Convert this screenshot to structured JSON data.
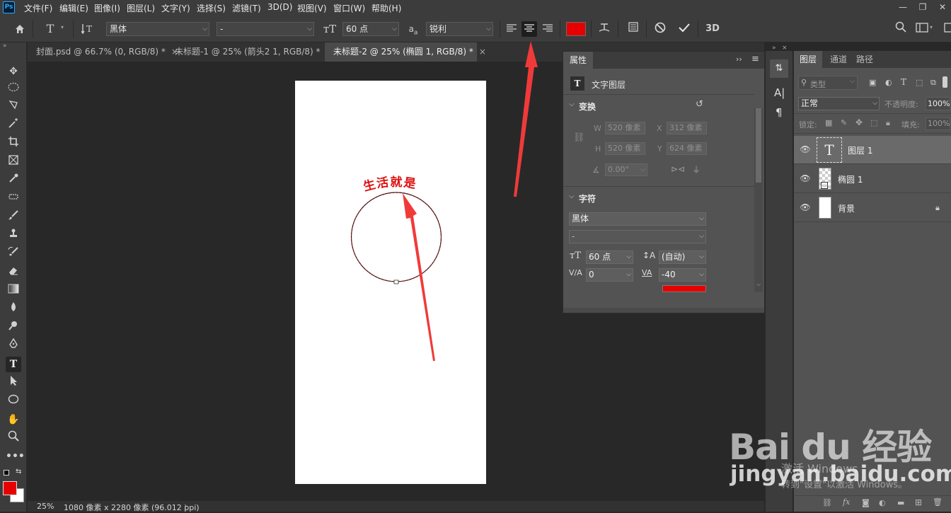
{
  "menubar": {
    "app_icon": "Ps",
    "items": [
      "文件(F)",
      "编辑(E)",
      "图像(I)",
      "图层(L)",
      "文字(Y)",
      "选择(S)",
      "滤镜(T)",
      "3D(D)",
      "视图(V)",
      "窗口(W)",
      "帮助(H)"
    ]
  },
  "options": {
    "font_family": "黑体",
    "font_style": "-",
    "font_size": "60 点",
    "aa_label": "a",
    "antialias": "锐利",
    "threed": "3D",
    "color": "#e60000"
  },
  "tabs": [
    {
      "label": "封面.psd @ 66.7% (0, RGB/8) *"
    },
    {
      "label": "未标题-1 @ 25% (箭头2 1, RGB/8) *"
    },
    {
      "label": "未标题-2 @ 25% (椭圆 1, RGB/8) *"
    }
  ],
  "canvas": {
    "path_text": "生活就是"
  },
  "status": {
    "zoom": "25%",
    "info": "1080 像素 x 2280 像素 (96.012 ppi)"
  },
  "properties": {
    "title": "属性",
    "layer_type": "文字图层",
    "transform": {
      "title": "变换",
      "w_label": "W",
      "w": "520 像素",
      "x_label": "X",
      "x": "312 像素",
      "h_label": "H",
      "h": "520 像素",
      "y_label": "Y",
      "y": "624 像素",
      "angle": "0.00°"
    },
    "character": {
      "title": "字符",
      "font": "黑体",
      "style": "-",
      "size": "60 点",
      "leading": "(自动)",
      "kerning": "0",
      "tracking": "-40",
      "color": "#e60000"
    }
  },
  "layers_panel": {
    "tabs": [
      "图层",
      "通道",
      "路径"
    ],
    "filter_kind": "类型",
    "blend_mode": "正常",
    "opacity_label": "不透明度:",
    "opacity": "100%",
    "lock_label": "锁定:",
    "fill_label": "填充:",
    "fill": "100%",
    "layers": [
      {
        "name": "图层 1",
        "selected": true
      },
      {
        "name": "椭圆 1",
        "selected": false
      },
      {
        "name": "背景",
        "selected": false
      }
    ]
  },
  "watermark": {
    "brand": "Bai du 经验",
    "url": "jingyan.baidu.com",
    "activate_line1": "激活 Windows",
    "activate_line2": "转到\"设置\"以激活 Windows。"
  },
  "colors": {
    "foreground": "#e60000",
    "background": "#ffffff",
    "arrow": "#f03a3a"
  }
}
